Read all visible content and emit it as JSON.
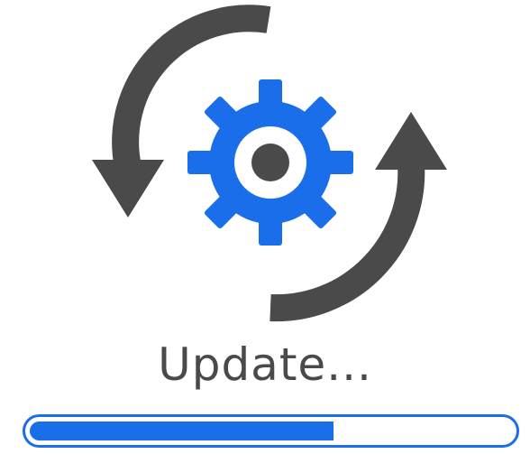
{
  "status": {
    "text": "Update..."
  },
  "progress": {
    "fraction": 0.63
  },
  "icons": {
    "gear": "gear-icon",
    "arrow_left": "rotating-arrow-left-icon",
    "arrow_right": "rotating-arrow-right-icon"
  },
  "colors": {
    "accent": "#1a6eea",
    "arrow": "#4a4a4a",
    "text": "#4a4a4a",
    "background": "#ffffff"
  }
}
